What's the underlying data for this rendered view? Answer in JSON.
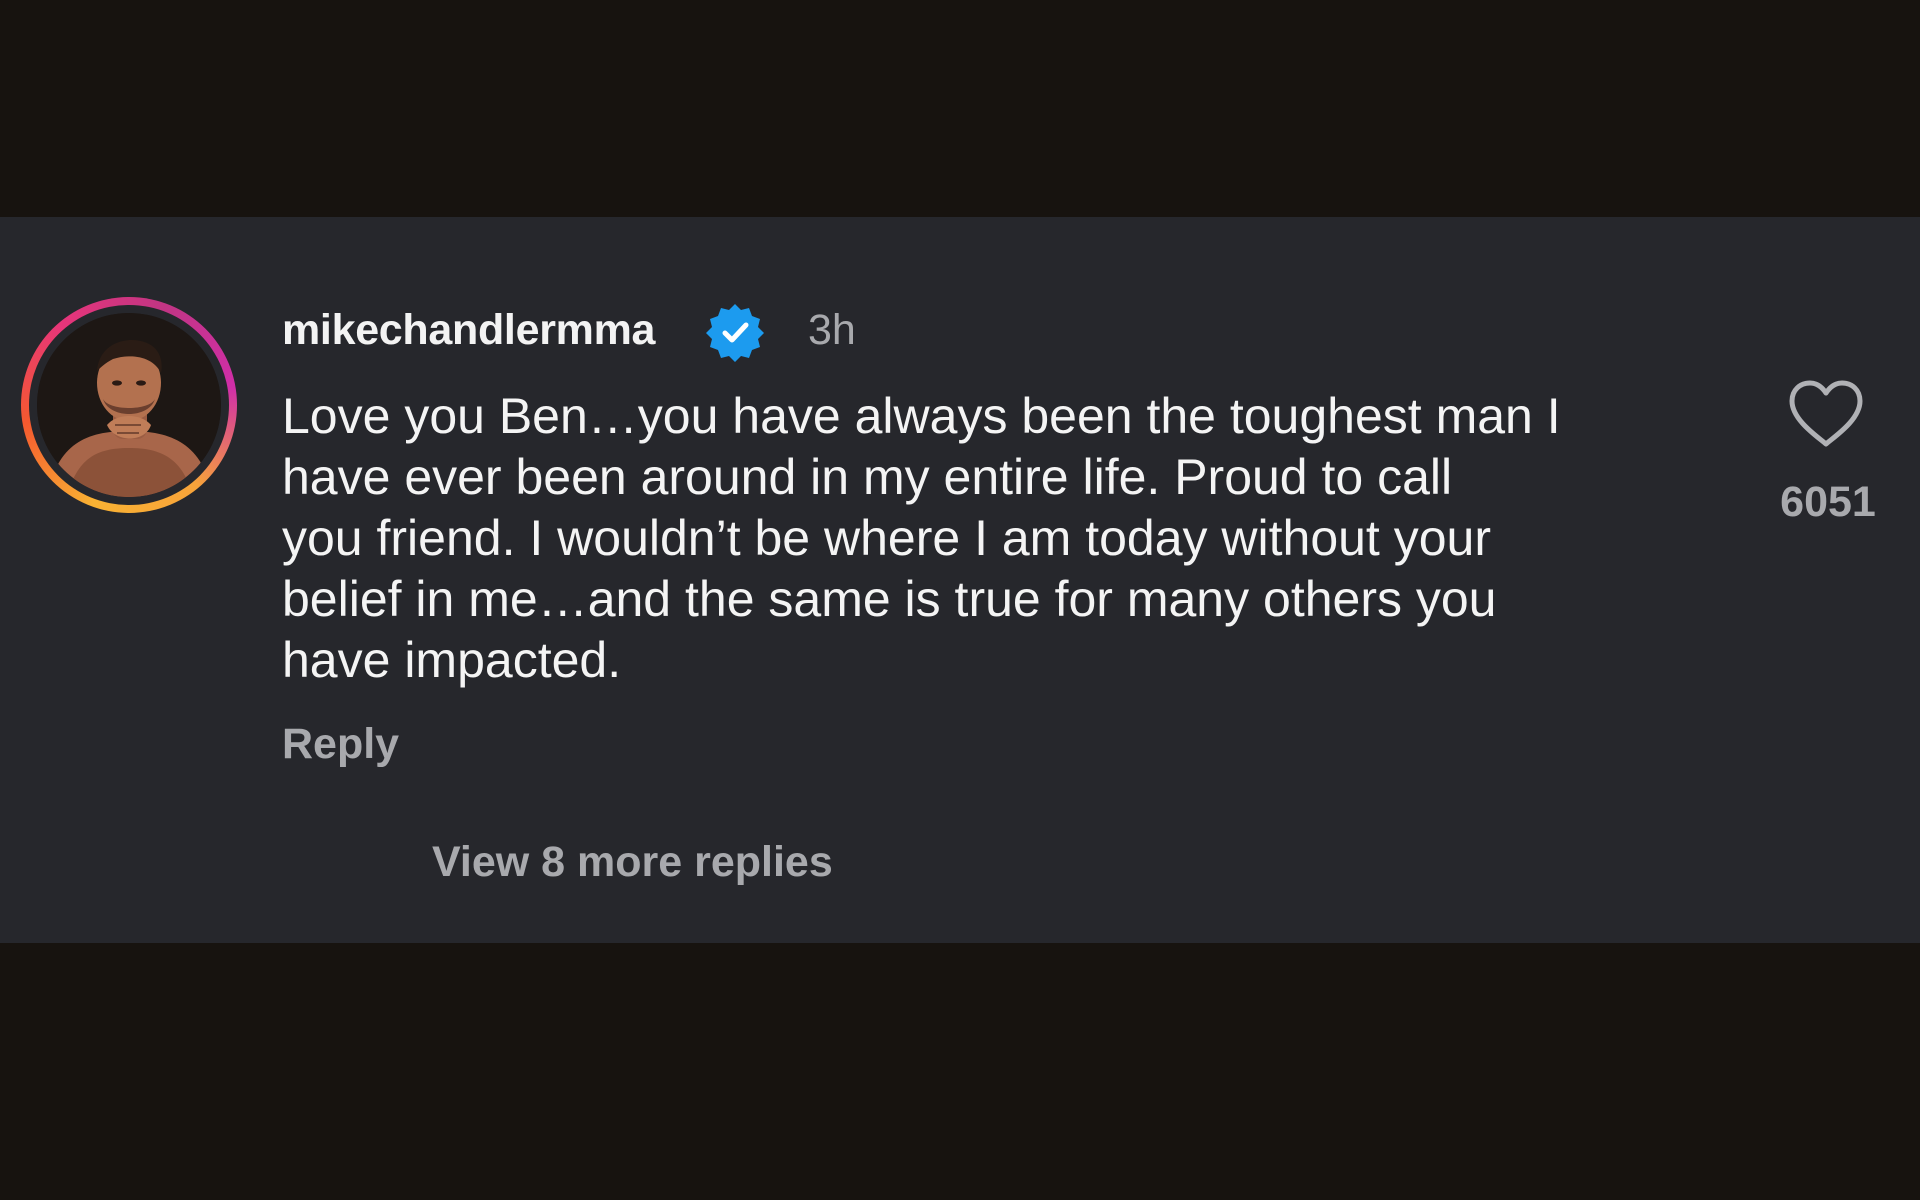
{
  "comment": {
    "username": "mikechandlermma",
    "verified_icon": "verified-badge-icon",
    "timestamp": "3h",
    "text": "Love you Ben…you have always been the toughest man I\nhave ever been around in my entire life. Proud to call\nyou friend. I wouldn’t be where I am today without your\nbelief in me…and the same is true for many others you\nhave impacted.",
    "reply_label": "Reply",
    "view_replies_label": "View 8 more replies",
    "like_icon": "heart-icon",
    "like_count": "6051"
  },
  "colors": {
    "background": "#17130f",
    "panel": "#26272c",
    "verified_blue": "#1c9bef",
    "muted_text": "#a8a9ad",
    "primary_text": "#f4f4f4"
  }
}
